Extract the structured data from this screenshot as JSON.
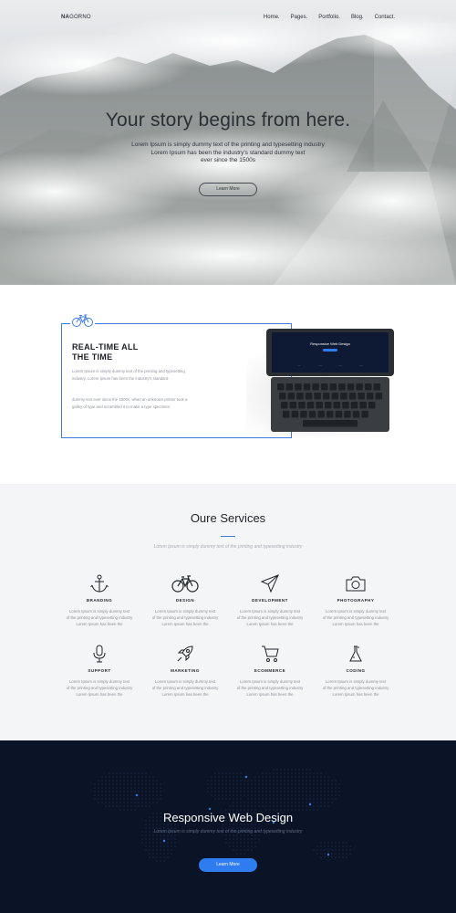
{
  "brand": {
    "bold": "NA",
    "rest": "GORNO"
  },
  "nav": {
    "items": [
      "Home.",
      "Pages.",
      "Portfolio.",
      "Blog.",
      "Contact."
    ]
  },
  "hero": {
    "title": "Your story begins from here.",
    "subtitle_lines": [
      "Lorem Ipsum is simply dummy text of the printing and typesetting industry",
      "Lorem Ipsum has been the industry's standard dummy text",
      "ever since the 1500s"
    ],
    "button": "Learn More"
  },
  "feature": {
    "title_lines": [
      "REAL-TIME ALL",
      "THE TIME"
    ],
    "paragraph1": "Lorem Ipsum is simply dummy text of the printing and typesetting industry. Lorem Ipsum has been the industry's standard",
    "paragraph2": "dummy text ever since the 1500s, when an unknown printer took a galley of type and scrambled it to make a type specimen",
    "icon": "bicycle-icon",
    "accent": "#3d7be0",
    "tablet": {
      "screen_title": "Responsive Web Design",
      "screen_menu": [
        "-----",
        "-----",
        "-----",
        "-----"
      ]
    }
  },
  "services": {
    "title": "Oure Services",
    "subtitle": "Lorem Ipsum is simply dummy text of the printing and typesetting industry",
    "items": [
      {
        "name": "BRANDING",
        "icon": "anchor-icon",
        "lines": [
          "Lorem Ipsum is simply dummy text",
          "of the printing and typesetting industry",
          "Lorem Ipsum has been the"
        ]
      },
      {
        "name": "DESIGN",
        "icon": "bicycle-icon",
        "lines": [
          "Lorem Ipsum is simply dummy text",
          "of the printing and typesetting industry",
          "Lorem Ipsum has been the"
        ]
      },
      {
        "name": "DEVELOPMENT",
        "icon": "paper-plane-icon",
        "lines": [
          "Lorem Ipsum is simply dummy text",
          "of the printing and typesetting industry",
          "Lorem Ipsum has been the"
        ]
      },
      {
        "name": "PHOTOGRAPHY",
        "icon": "camera-icon",
        "lines": [
          "Lorem Ipsum is simply dummy text",
          "of the printing and typesetting industry",
          "Lorem Ipsum has been the"
        ]
      },
      {
        "name": "SUPPORT",
        "icon": "microphone-icon",
        "lines": [
          "Lorem Ipsum is simply dummy text",
          "of the printing and typesetting industry",
          "Lorem Ipsum has been the"
        ]
      },
      {
        "name": "MARKETING",
        "icon": "rocket-icon",
        "lines": [
          "Lorem Ipsum is simply dummy text",
          "of the printing and typesetting industry",
          "Lorem Ipsum has been the"
        ]
      },
      {
        "name": "ECOMMERCE",
        "icon": "shopping-cart-icon",
        "lines": [
          "Lorem Ipsum is simply dummy text",
          "of the printing and typesetting industry",
          "Lorem Ipsum has been the"
        ]
      },
      {
        "name": "CODING",
        "icon": "flask-icon",
        "lines": [
          "Lorem Ipsum is simply dummy text",
          "of the printing and typesetting industry",
          "Lorem Ipsum has been the"
        ]
      }
    ]
  },
  "cta": {
    "title": "Responsive Web Design",
    "subtitle": "Lorem Ipsum is simply dummy text of the printing and typesetting industry",
    "button": "Learn More",
    "button_color": "#2f7bf0",
    "background": "#0b1426"
  }
}
